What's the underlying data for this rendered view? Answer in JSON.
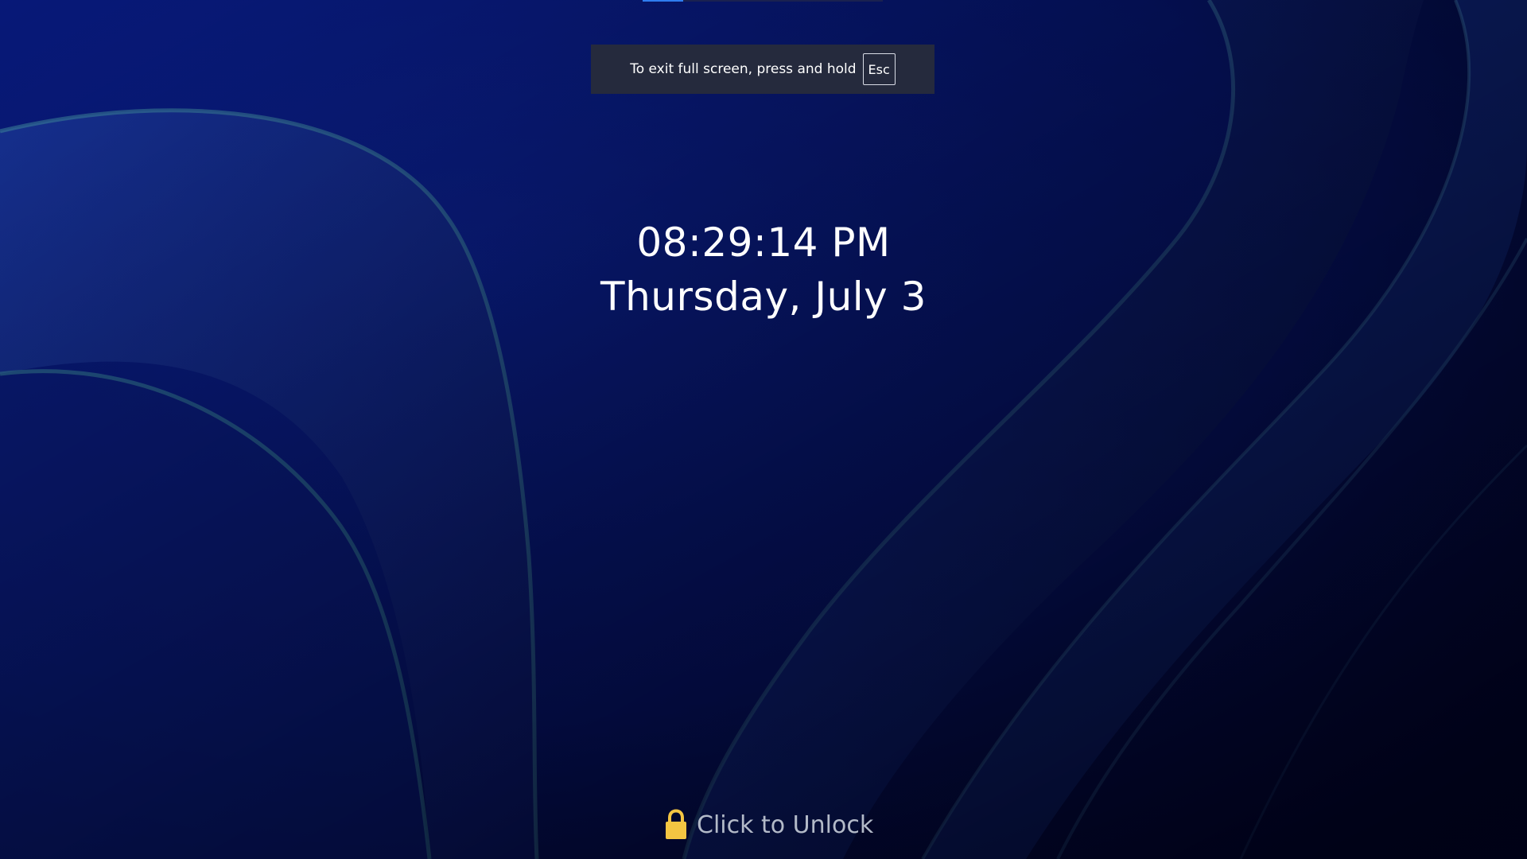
{
  "fullscreen_notice": {
    "message": "To exit full screen, press and hold",
    "key_label": "Esc"
  },
  "top_indicator": {
    "progress_fraction": 0.17
  },
  "lock_screen": {
    "time": "08:29:14 PM",
    "date": "Thursday, July 3"
  },
  "unlock": {
    "label": "Click to Unlock",
    "icon": "lock-icon"
  },
  "colors": {
    "background": "#07166e",
    "toast_background": "#252a3d",
    "lock_icon": "#f4c542",
    "unlock_text": "#b3bac8",
    "accent": "#2f7df0"
  }
}
